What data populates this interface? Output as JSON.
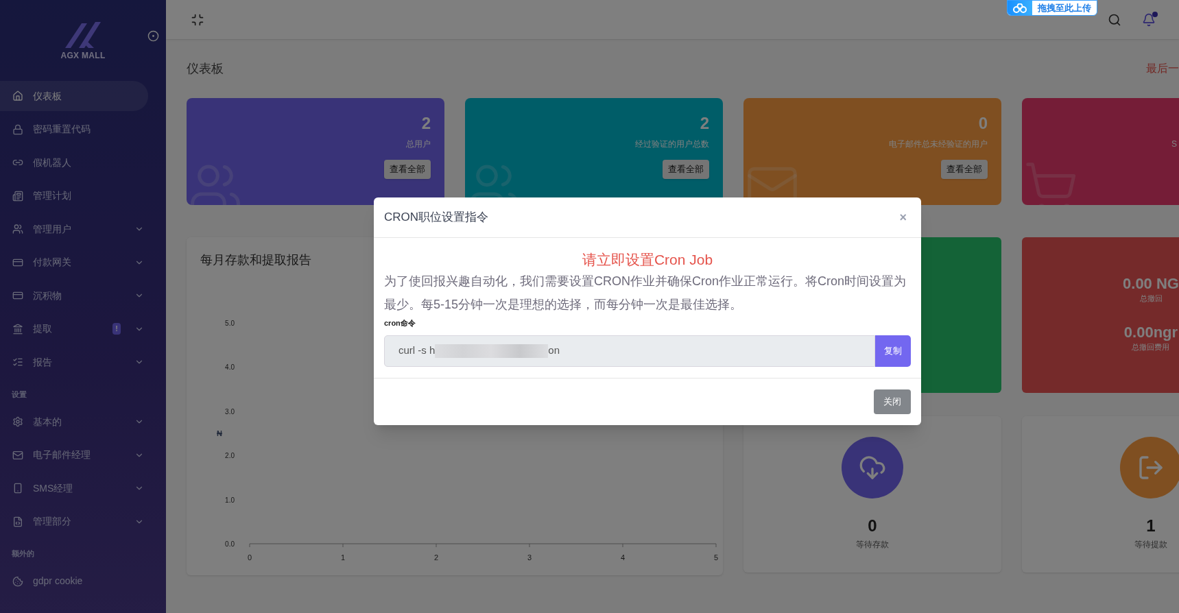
{
  "sidebar": {
    "logo": "AGX MALL",
    "items": [
      {
        "label": "仪表板",
        "selected": true,
        "has_submenu": false
      },
      {
        "label": "密码重置代码",
        "selected": false,
        "has_submenu": false
      },
      {
        "label": "假机器人",
        "selected": false,
        "has_submenu": false
      },
      {
        "label": "管理计划",
        "selected": false,
        "has_submenu": false
      },
      {
        "label": "管理用户",
        "selected": false,
        "has_submenu": true
      },
      {
        "label": "付款网关",
        "selected": false,
        "has_submenu": true
      },
      {
        "label": "沉积物",
        "selected": false,
        "has_submenu": true
      },
      {
        "label": "提取",
        "selected": false,
        "has_submenu": true,
        "badge": "!"
      },
      {
        "label": "报告",
        "selected": false,
        "has_submenu": true
      },
      {
        "kind": "section",
        "label": "设置"
      },
      {
        "label": "基本的",
        "selected": false,
        "has_submenu": true
      },
      {
        "label": "电子邮件经理",
        "selected": false,
        "has_submenu": true
      },
      {
        "label": "SMS经理",
        "selected": false,
        "has_submenu": true
      },
      {
        "label": "管理部分",
        "selected": false,
        "has_submenu": true
      },
      {
        "kind": "section",
        "label": "额外的"
      },
      {
        "label": "gdpr cookie",
        "selected": false,
        "has_submenu": false
      }
    ]
  },
  "topbar": {
    "upload_badge": "拖拽至此上传",
    "notification_dot": true
  },
  "page": {
    "title": "仪表板",
    "last_text": "最后一"
  },
  "stat_cards": [
    {
      "value": "2",
      "label": "总用户",
      "button": "查看全部"
    },
    {
      "value": "2",
      "label": "经过验证的用户总数",
      "button": "查看全部"
    },
    {
      "value": "0",
      "label": "电子邮件总未经验证的用户",
      "button": "查看全部"
    },
    {
      "label": "S"
    }
  ],
  "report": {
    "title": "每月存款和提取报告",
    "chart_data": {
      "type": "line",
      "ylabel": "₦",
      "xlim": [
        0,
        5
      ],
      "ylim": [
        0,
        5
      ],
      "xticks": [
        0,
        1,
        2,
        3,
        4,
        5
      ],
      "yticks": [
        {
          "value": 0,
          "label": "0.0"
        },
        {
          "value": 1,
          "label": "1.0"
        },
        {
          "value": 2,
          "label": "2.0"
        },
        {
          "value": 3,
          "label": "3.0"
        },
        {
          "value": 4,
          "label": "4.0"
        },
        {
          "value": 5,
          "label": "5.0"
        }
      ]
    }
  },
  "withdraw_card": {
    "lines": [
      {
        "value": "0.00 NG",
        "label": "总撤回"
      },
      {
        "value": "0.00ngr",
        "label": "总撤回费用"
      }
    ]
  },
  "pending_cards": [
    {
      "value": "0",
      "label": "等待存款"
    },
    {
      "value": "1",
      "label": "等待提款"
    }
  ],
  "modal": {
    "title": "CRON职位设置指令",
    "close": "×",
    "heading": "请立即设置Cron Job",
    "text": "为了使回报兴趣自动化，我们需要设置CRON作业并确保Cron作业正常运行。将Cron时间设置为最少。每5-15分钟一次是理想的选择，而每分钟一次是最佳选择。",
    "field_label": "cron命令",
    "command_start": "curl -s h",
    "command_end": "on",
    "copy_button": "复制",
    "close_button": "关闭"
  }
}
